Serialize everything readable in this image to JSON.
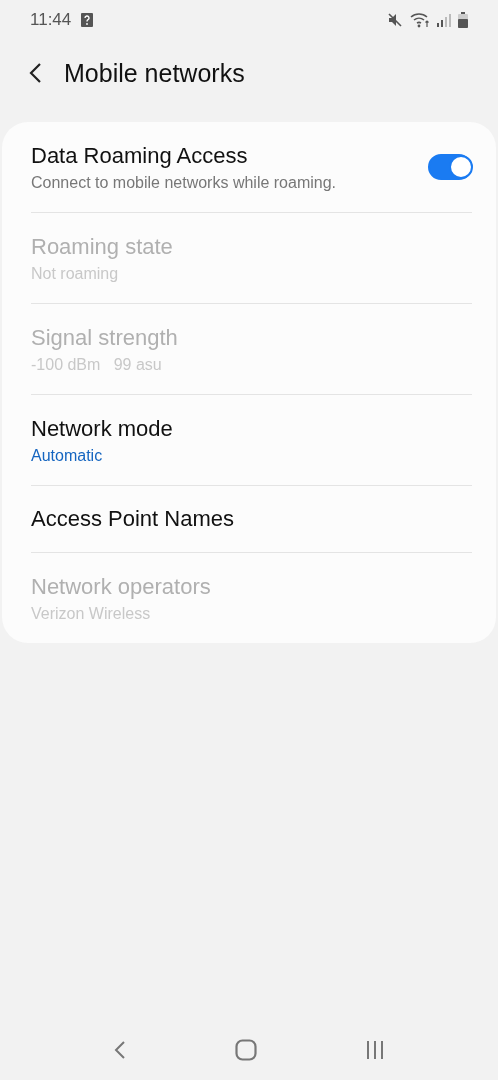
{
  "status_bar": {
    "time": "11:44"
  },
  "header": {
    "title": "Mobile networks"
  },
  "settings": [
    {
      "kind": "switch",
      "title": "Data Roaming Access",
      "summary": "Connect to mobile networks while roaming.",
      "on": true,
      "disabled": false
    },
    {
      "kind": "info",
      "title": "Roaming state",
      "summary": "Not roaming",
      "disabled": true
    },
    {
      "kind": "info",
      "title": "Signal strength",
      "summary": "-100 dBm   99 asu",
      "disabled": true
    },
    {
      "kind": "selector",
      "title": "Network mode",
      "summary": "Automatic",
      "disabled": false
    },
    {
      "kind": "info",
      "title": "Access Point Names",
      "disabled": false
    },
    {
      "kind": "info",
      "title": "Network operators",
      "summary": "Verizon Wireless",
      "disabled": true
    }
  ]
}
